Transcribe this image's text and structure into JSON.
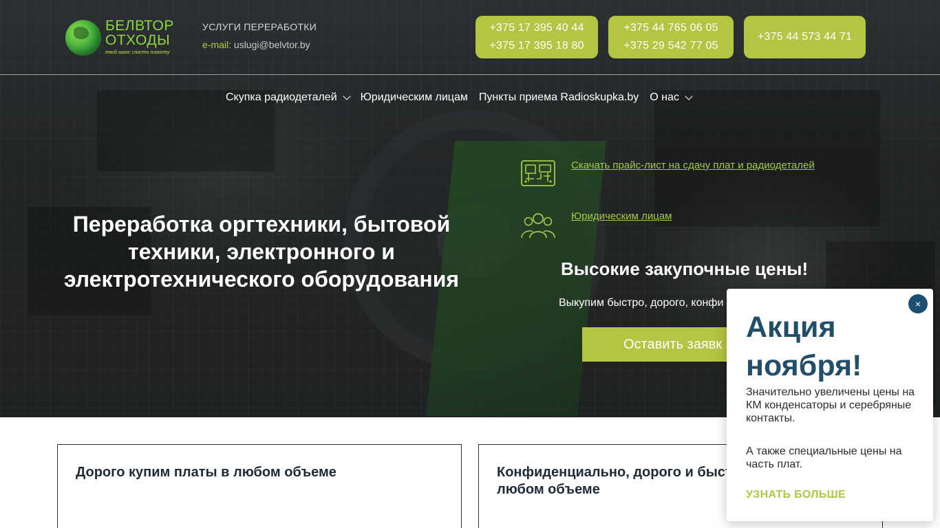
{
  "brand": {
    "logo_title_line1": "БЕЛВТОР",
    "logo_title_line2": "ОТХОДЫ",
    "logo_tagline": "твой шанс спасти планету",
    "accent_color": "#b3c543",
    "dark_blue": "#234e6a"
  },
  "header": {
    "services_title": "УСЛУГИ ПЕРЕРАБОТКИ",
    "email_label": "e-mail:",
    "email_value": "uslugi@belvtor.by",
    "phones": [
      {
        "line1": "+375 17 395 40 44",
        "line2": "+375 17 395 18 80"
      },
      {
        "line1": "+375 44 765 06 05",
        "line2": "+375 29 542 77 05"
      },
      {
        "line1": "+375 44 573 44 71"
      }
    ]
  },
  "nav": {
    "items": [
      {
        "label": "Скупка радиодеталей",
        "has_dropdown": true
      },
      {
        "label": "Юридическим лицам",
        "has_dropdown": false
      },
      {
        "label": "Пункты приема Radioskupka.by",
        "has_dropdown": false
      },
      {
        "label": "О нас",
        "has_dropdown": true
      }
    ]
  },
  "hero": {
    "title": "Переработка оргтехники, бытовой техники, электронного и электротехнического оборудования",
    "link_pricelist": "Скачать прайс-лист на сдачу плат и радиодеталей",
    "link_pricelist_icon": "circuit-board-icon",
    "link_legal": "Юридическим лицам",
    "link_legal_icon": "people-group-icon",
    "prices_title": "Высокие закупочные цены!",
    "prices_sub": "Выкупим быстро, дорого, конфи",
    "cta_label": "Оставить заявк"
  },
  "cards": [
    {
      "title": "Дорого купим платы в любом объеме"
    },
    {
      "title": "Конфиденциально, дорого и быстр радиодетали в любом объеме"
    }
  ],
  "popup": {
    "close_symbol": "×",
    "title": "Акция ноября!",
    "text1": "Значительно увеличены цены на КМ конденсаторы и серебряные контакты.",
    "text2": "А также специальные цены на часть плат.",
    "more_label": "УЗНАТЬ БОЛЬШЕ"
  }
}
